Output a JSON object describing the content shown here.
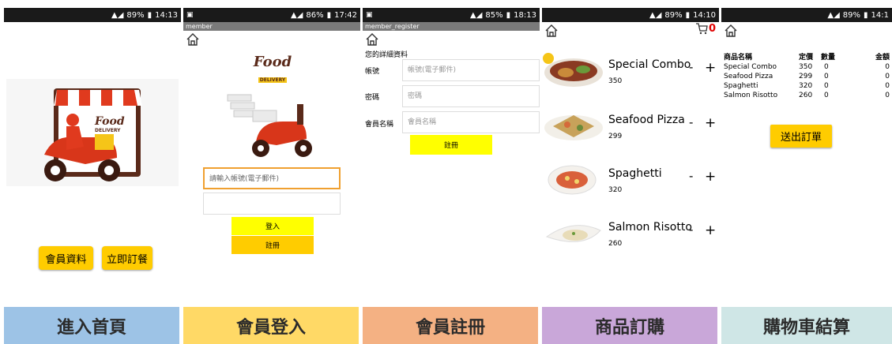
{
  "screens": {
    "home": {
      "status": {
        "signal": "89%",
        "time": "14:13"
      },
      "member_button": "會員資料",
      "order_button": "立即訂餐",
      "caption": "進入首頁"
    },
    "login": {
      "status": {
        "signal": "86%",
        "time": "17:42"
      },
      "title": "member",
      "logo_top": "Food",
      "logo_bottom": "DELIVERY",
      "account_placeholder": "請輸入帳號(電子郵件)",
      "password_placeholder": "",
      "login_button": "登入",
      "register_button": "註冊",
      "caption": "會員登入"
    },
    "register": {
      "status": {
        "signal": "85%",
        "time": "18:13"
      },
      "title": "member_register",
      "heading": "您的詳細資料",
      "fields": [
        {
          "label": "帳號",
          "placeholder": "帳號(電子郵件)"
        },
        {
          "label": "密碼",
          "placeholder": "密碼"
        },
        {
          "label": "會員名稱",
          "placeholder": "會員名稱"
        }
      ],
      "submit_button": "註冊",
      "caption": "會員註冊"
    },
    "products": {
      "status": {
        "signal": "89%",
        "time": "14:10"
      },
      "cart_count": "0",
      "items": [
        {
          "name": "Special Combo",
          "price": "350",
          "minus": "-",
          "plus": "+"
        },
        {
          "name": "Seafood Pizza",
          "price": "299",
          "minus": "-",
          "plus": "+"
        },
        {
          "name": "Spaghetti",
          "price": "320",
          "minus": "-",
          "plus": "+"
        },
        {
          "name": "Salmon Risotto",
          "price": "260",
          "minus": "-",
          "plus": "+"
        }
      ],
      "caption": "商品訂購"
    },
    "cart": {
      "status": {
        "signal": "89%",
        "time": "14:1"
      },
      "headers": [
        "商品名稱",
        "定價",
        "數量",
        "金額"
      ],
      "rows": [
        [
          "Special Combo",
          "350",
          "0",
          "0"
        ],
        [
          "Seafood Pizza",
          "299",
          "0",
          "0"
        ],
        [
          "Spaghetti",
          "320",
          "0",
          "0"
        ],
        [
          "Salmon Risotto",
          "260",
          "0",
          "0"
        ]
      ],
      "submit_button": "送出訂單",
      "caption": "購物車結算"
    }
  },
  "colors": {
    "accent_yellow": "#ffcc00",
    "field_yellow": "#ffff00",
    "cart_red": "#e00000",
    "caption_home": "#9dc3e6",
    "caption_login": "#ffd966",
    "caption_register": "#f4b183",
    "caption_products": "#c9a7d9",
    "caption_cart": "#cfe6e6"
  }
}
